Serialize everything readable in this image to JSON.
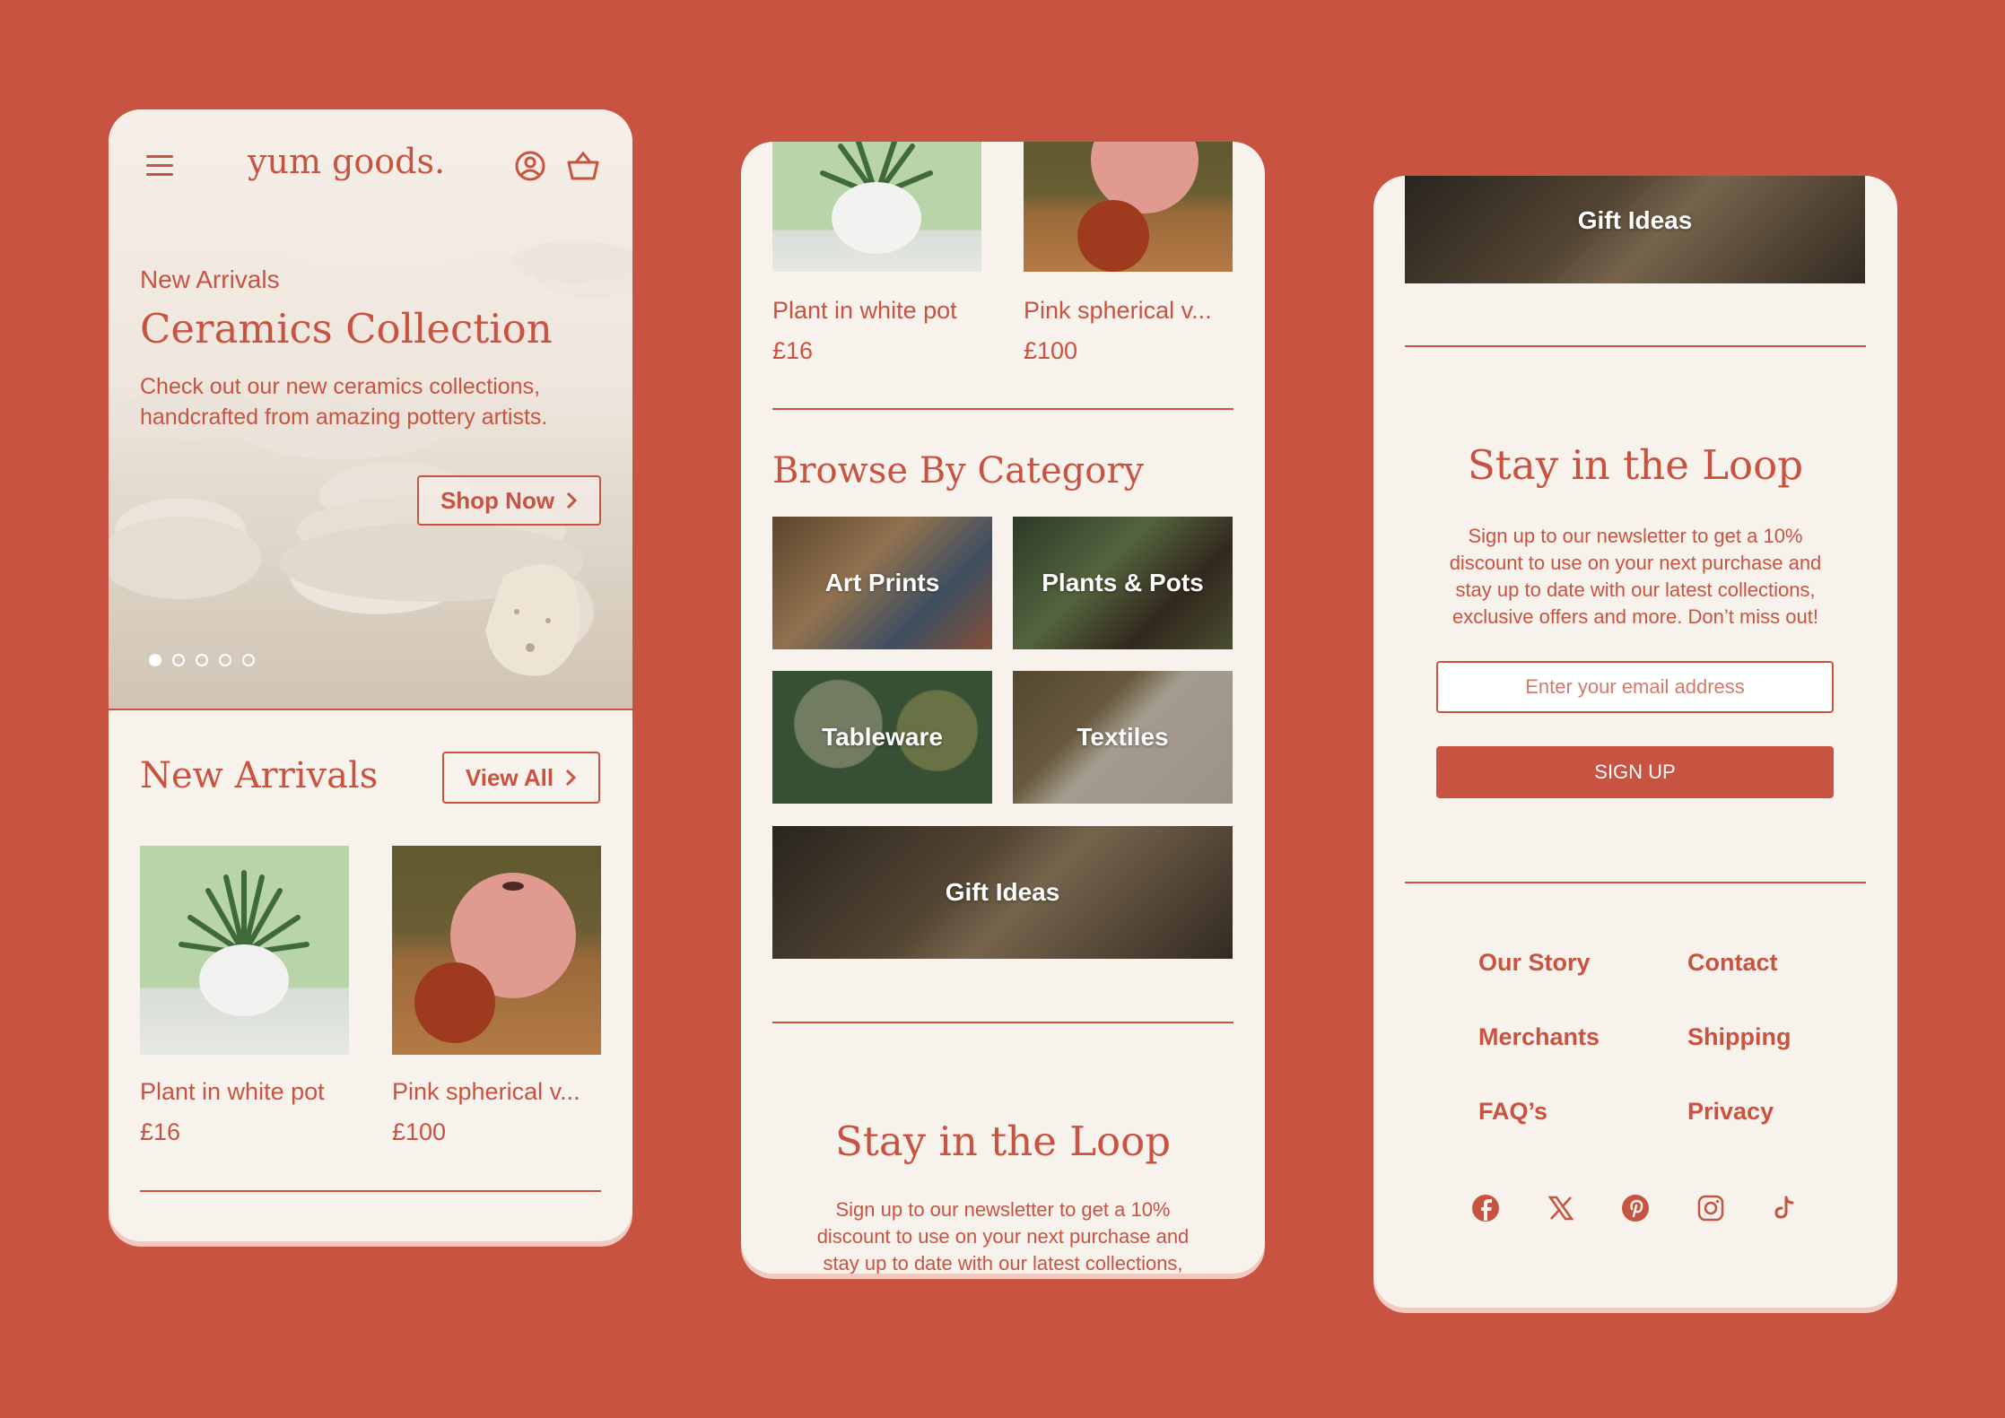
{
  "colors": {
    "brand": "#c85341",
    "background": "#f8f2ec",
    "page_bg": "#c85341"
  },
  "phone1": {
    "header": {
      "menu_icon": "hamburger-icon",
      "logo": "yum goods.",
      "account_icon": "user-circle-icon",
      "cart_icon": "basket-icon"
    },
    "hero": {
      "eyebrow": "New Arrivals",
      "title": "Ceramics Collection",
      "body": "Check out our new ceramics collections, handcrafted from amazing pottery artists.",
      "cta": "Shop Now",
      "slide_count": 5,
      "active_slide": 1
    },
    "new_arrivals": {
      "title": "New Arrivals",
      "view_all": "View All",
      "products": [
        {
          "name": "Plant in white pot",
          "price": "£16"
        },
        {
          "name": "Pink spherical v...",
          "price": "£100"
        }
      ]
    }
  },
  "phone2": {
    "products": [
      {
        "name": "Plant in white pot",
        "price": "£16"
      },
      {
        "name": "Pink spherical v...",
        "price": "£100"
      }
    ],
    "categories": {
      "title": "Browse By Category",
      "items": [
        "Art Prints",
        "Plants & Pots",
        "Tableware",
        "Textiles",
        "Gift Ideas"
      ]
    },
    "newsletter": {
      "title": "Stay in the Loop",
      "body_line1": "Sign up to our newsletter to get a 10%",
      "body_line2": "discount to use on your next purchase and",
      "body_line3": "stay up to date with our latest collections,"
    }
  },
  "phone3": {
    "banner": "Gift Ideas",
    "newsletter": {
      "title": "Stay in the Loop",
      "body_line1": "Sign up to our newsletter to get a 10%",
      "body_line2": "discount to use on your next purchase and",
      "body_line3": "stay up to date with our latest collections,",
      "body_line4": "exclusive offers and more. Don’t miss out!",
      "placeholder": "Enter your email address",
      "button": "SIGN UP"
    },
    "footer": {
      "links": [
        "Our Story",
        "Contact",
        "Merchants",
        "Shipping",
        "FAQ’s",
        "Privacy"
      ],
      "social": [
        "facebook-icon",
        "x-icon",
        "pinterest-icon",
        "instagram-icon",
        "tiktok-icon"
      ]
    }
  }
}
